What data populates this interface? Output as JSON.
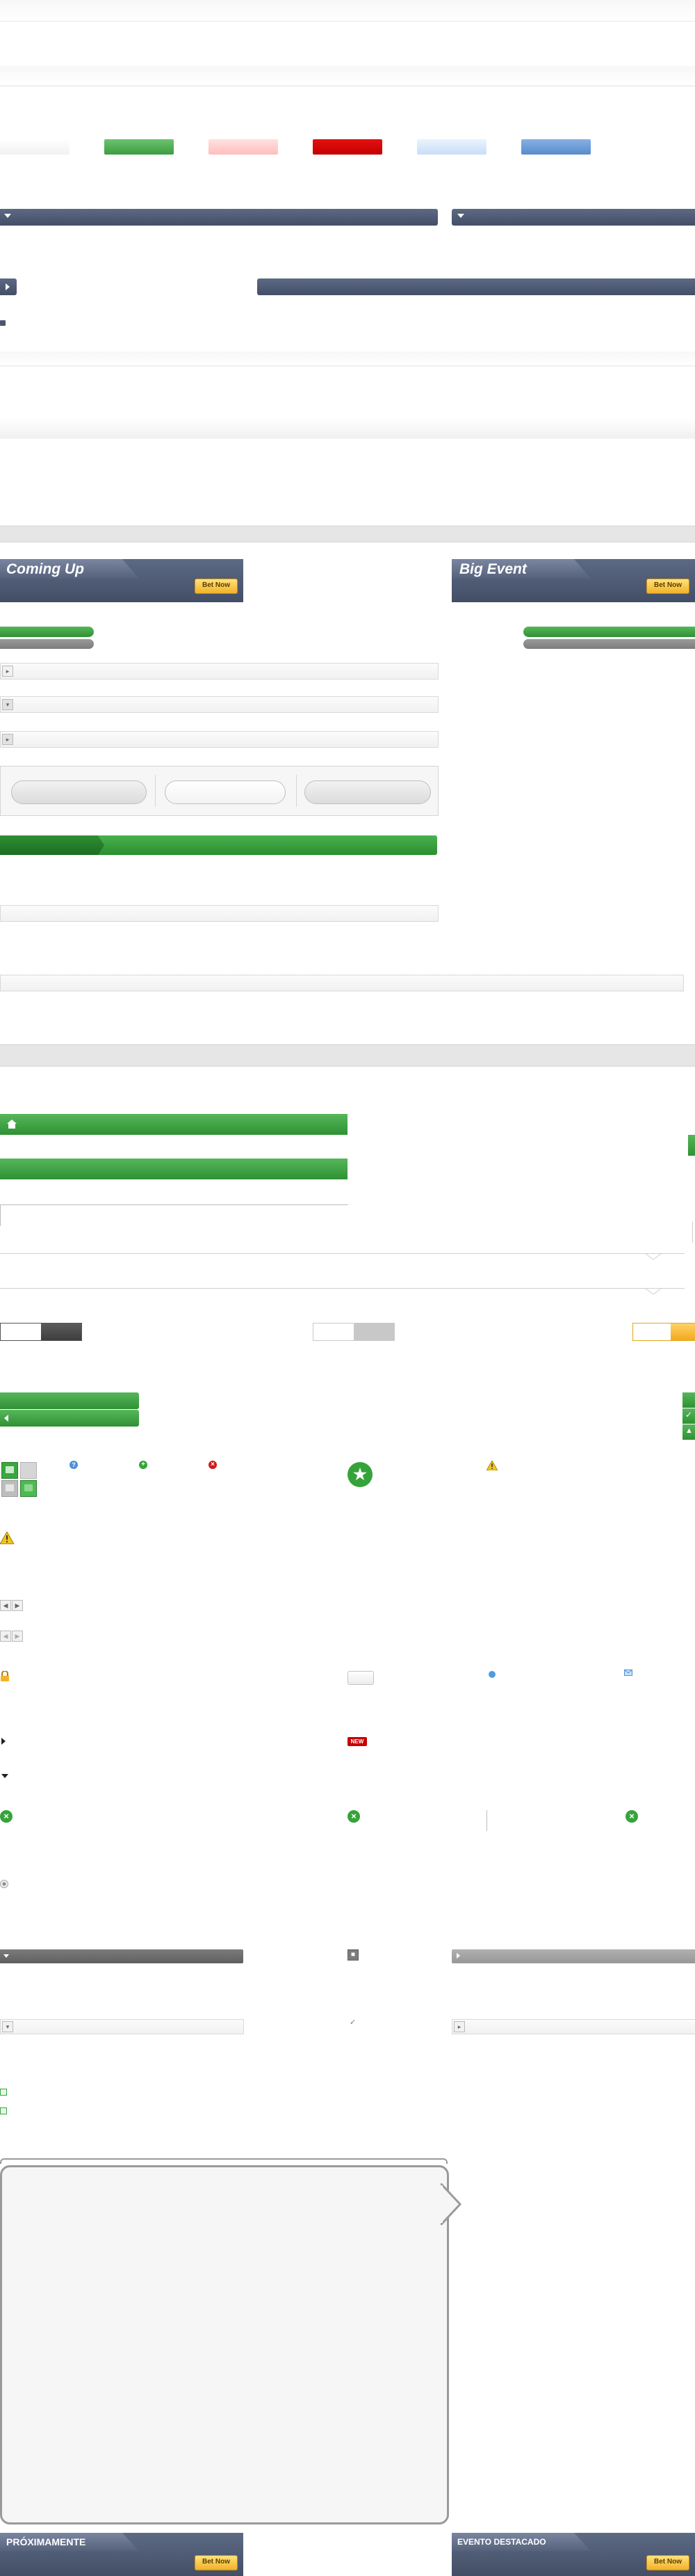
{
  "colors": {
    "navy": "#4a5570",
    "green": "#3aa83e",
    "red": "#d40000",
    "pink": "#ffd0d0",
    "light_blue": "#d6e8fb",
    "blue": "#6f9ed8",
    "yellow_button": "#f7c33b",
    "gray": "#8a8a8a"
  },
  "banners": {
    "coming_up": {
      "title": "Coming Up",
      "button": "Bet Now"
    },
    "big_event": {
      "title": "Big Event",
      "button": "Bet Now"
    },
    "proximamente": {
      "title": "PRÓXIMAMENTE",
      "button": "Bet Now"
    },
    "evento_destacado": {
      "title": "EVENTO DESTACADO",
      "button": "Bet Now"
    }
  },
  "badges": {
    "new": "NEW"
  },
  "icons": {
    "home": "home-icon",
    "star": "star-icon",
    "warning": "warning-icon",
    "lock": "lock-icon",
    "close": "close-icon",
    "help": "help-icon",
    "add": "add-icon",
    "remove": "remove-icon",
    "check": "check-icon",
    "arrow_right": "arrow-right-icon",
    "arrow_down": "arrow-down-icon"
  }
}
